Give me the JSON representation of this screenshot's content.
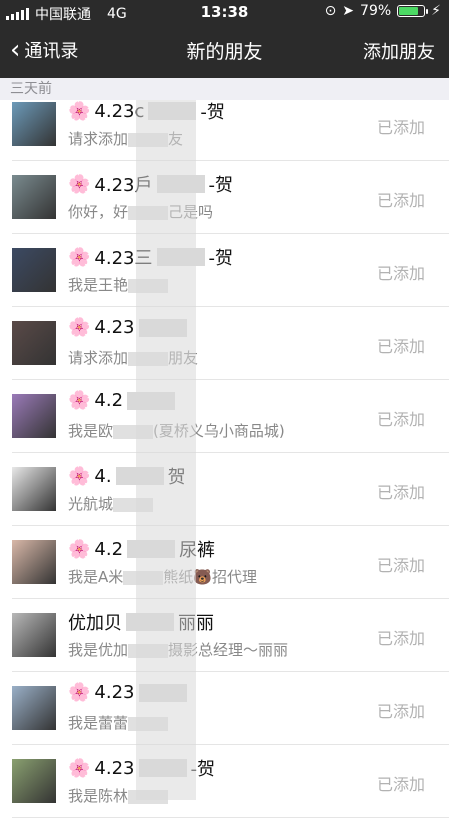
{
  "status_bar": {
    "carrier": "中国联通",
    "network": "4G",
    "time": "13:38",
    "battery_percent": "79%",
    "battery_level": 0.79
  },
  "nav": {
    "back_label": "通讯录",
    "title": "新的朋友",
    "action_label": "添加朋友"
  },
  "section": {
    "header": "三天前"
  },
  "contacts": [
    {
      "flower": "🌸",
      "name": "4.23c",
      "name_suffix": "-贺",
      "message": "请求添加",
      "message_suffix": "友",
      "status": "已添加"
    },
    {
      "flower": "🌸",
      "name": "4.23戶",
      "name_suffix": "-贺",
      "message": "你好，好",
      "message_suffix": "己是吗",
      "status": "已添加"
    },
    {
      "flower": "🌸",
      "name": "4.23三",
      "name_suffix": "-贺",
      "message": "我是王艳",
      "message_suffix": "",
      "status": "已添加"
    },
    {
      "flower": "🌸",
      "name": "4.23",
      "name_suffix": "",
      "message": "请求添加",
      "message_suffix": "朋友",
      "status": "已添加"
    },
    {
      "flower": "🌸",
      "name": "4.2",
      "name_suffix": "",
      "message": "我是欧",
      "message_suffix": "(夏桥义乌小商品城)",
      "status": "已添加"
    },
    {
      "flower": "🌸",
      "name": "4.",
      "name_suffix": "贺",
      "message": "光航城",
      "message_suffix": "",
      "status": "已添加"
    },
    {
      "flower": "🌸",
      "name": "4.2",
      "name_suffix": "尿裤",
      "message": "我是A米",
      "message_suffix": "熊纸",
      "message_emoji": "🐻",
      "message_tail": "招代理",
      "status": "已添加"
    },
    {
      "flower": "",
      "name": "优加贝",
      "name_suffix": "丽丽",
      "message": "我是优加",
      "message_suffix": "摄影总经理～丽丽",
      "status": "已添加"
    },
    {
      "flower": "🌸",
      "name": "4.23",
      "name_suffix": "",
      "message": "我是蕾蕾",
      "message_suffix": "",
      "status": "已添加"
    },
    {
      "flower": "🌸",
      "name": "4.23",
      "name_suffix": "-贺",
      "message": "我是陈林",
      "message_suffix": "",
      "status": "已添加"
    }
  ],
  "colors": {
    "nav_bg": "#2b2b2b",
    "status_text": "#b2b2b2",
    "battery": "#4cd964"
  }
}
